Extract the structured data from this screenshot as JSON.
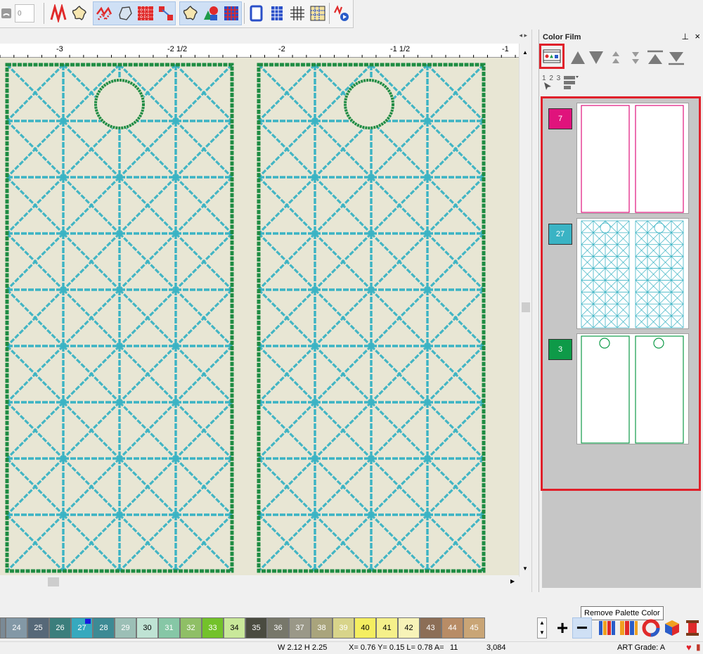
{
  "toolbar": {
    "stitch_field_value": "0",
    "groups": [
      {
        "name": "stitch-tools",
        "icons": [
          "zigzag-stitch-icon",
          "flower-stitch-icon"
        ]
      },
      {
        "name": "object-tools",
        "icons": [
          "fill-zigzag-icon",
          "crystal-shape-icon",
          "pattern-fill-icon",
          "reshape-icon"
        ]
      },
      {
        "name": "motif-tools",
        "icons": [
          "motif-flower-icon",
          "shapes-icon",
          "grid-pattern-icon"
        ]
      },
      {
        "name": "view-tools",
        "icons": [
          "hoop-frame-icon",
          "grid-frame-icon",
          "grid-lines-icon",
          "ruler-grid-icon"
        ]
      },
      {
        "name": "play-tools",
        "icons": [
          "stitch-player-icon"
        ]
      }
    ]
  },
  "ruler": {
    "labels": [
      "-3",
      "-2 1/2",
      "-2",
      "-1 1/2",
      "-1"
    ]
  },
  "panel": {
    "title": "Color Film",
    "pin_glyph": "⊥",
    "close_glyph": "×",
    "sort_label": "1 2 3",
    "rows": [
      {
        "number": "7",
        "color": "#e0137c",
        "thumb_stroke": "#e0137c",
        "thumb_type": "outline"
      },
      {
        "number": "27",
        "color": "#3ab3c4",
        "thumb_stroke": "#3ab3c4",
        "thumb_type": "grid"
      },
      {
        "number": "3",
        "color": "#0e9a48",
        "thumb_stroke": "#0e9a48",
        "thumb_type": "outline-circle"
      }
    ]
  },
  "palette": {
    "swatches": [
      {
        "label": "",
        "color": "#7a8a96",
        "text_color": "#ffffff"
      },
      {
        "label": "24",
        "color": "#8398a6",
        "text_color": "#ffffff"
      },
      {
        "label": "25",
        "color": "#566878",
        "text_color": "#ffffff"
      },
      {
        "label": "26",
        "color": "#3b7e7c",
        "text_color": "#ffffff"
      },
      {
        "label": "27",
        "color": "#36a9be",
        "text_color": "#ffffff",
        "current": true
      },
      {
        "label": "28",
        "color": "#3d8a94",
        "text_color": "#ffffff"
      },
      {
        "label": "29",
        "color": "#9cbfb6",
        "text_color": "#ffffff"
      },
      {
        "label": "30",
        "color": "#bfe3d4",
        "text_color": "#000000"
      },
      {
        "label": "31",
        "color": "#86c7a6",
        "text_color": "#ffffff"
      },
      {
        "label": "32",
        "color": "#8fbf66",
        "text_color": "#ffffff"
      },
      {
        "label": "33",
        "color": "#73c22a",
        "text_color": "#ffffff"
      },
      {
        "label": "34",
        "color": "#c9e89a",
        "text_color": "#000000"
      },
      {
        "label": "35",
        "color": "#4a4b40",
        "text_color": "#ffffff"
      },
      {
        "label": "36",
        "color": "#77776a",
        "text_color": "#ffffff"
      },
      {
        "label": "37",
        "color": "#9a9888",
        "text_color": "#ffffff"
      },
      {
        "label": "38",
        "color": "#a9a47c",
        "text_color": "#ffffff"
      },
      {
        "label": "39",
        "color": "#d8d48a",
        "text_color": "#ffffff"
      },
      {
        "label": "40",
        "color": "#f4ee60",
        "text_color": "#000000"
      },
      {
        "label": "41",
        "color": "#f5f08a",
        "text_color": "#000000"
      },
      {
        "label": "42",
        "color": "#f7f3b8",
        "text_color": "#000000"
      },
      {
        "label": "43",
        "color": "#8c6e56",
        "text_color": "#ffffff"
      },
      {
        "label": "44",
        "color": "#b88c66",
        "text_color": "#ffffff"
      },
      {
        "label": "45",
        "color": "#c9a576",
        "text_color": "#ffffff"
      }
    ],
    "add_glyph": "+",
    "remove_glyph": "−",
    "tooltip": "Remove Palette Color"
  },
  "status": {
    "dimensions": "W 2.12 H 2.25",
    "coords": "X= 0.76 Y= 0.15 L= 0.78 A=",
    "angle": "11",
    "stitches": "3,084",
    "grade": "ART Grade: A"
  },
  "colors": {
    "outline_green": "#1f8c43",
    "grid_teal": "#3ab3c4",
    "fabric": "#e8e6d4",
    "highlight_red": "#e0202a"
  }
}
